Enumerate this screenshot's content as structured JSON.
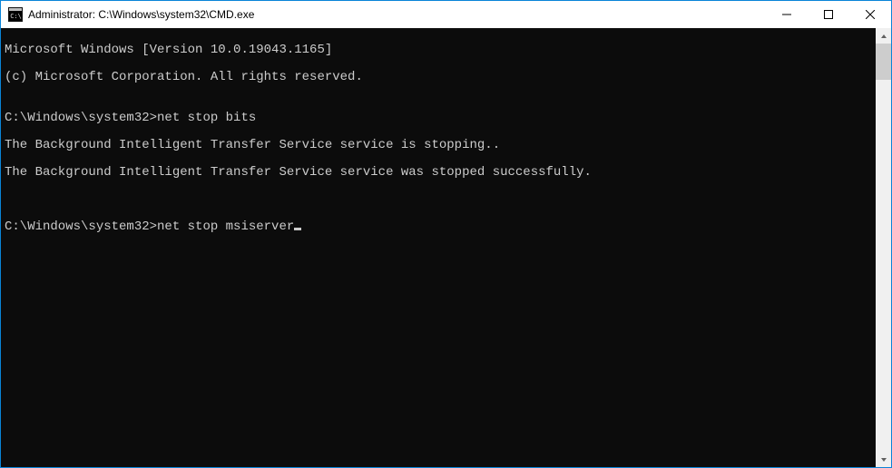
{
  "window": {
    "title": "Administrator: C:\\Windows\\system32\\CMD.exe"
  },
  "terminal": {
    "line1": "Microsoft Windows [Version 10.0.19043.1165]",
    "line2": "(c) Microsoft Corporation. All rights reserved.",
    "blank1": "",
    "prompt1": "C:\\Windows\\system32>",
    "cmd1": "net stop bits",
    "out1": "The Background Intelligent Transfer Service service is stopping..",
    "out2": "The Background Intelligent Transfer Service service was stopped successfully.",
    "blank2": "",
    "blank3": "",
    "prompt2": "C:\\Windows\\system32>",
    "cmd2": "net stop msiserver"
  }
}
